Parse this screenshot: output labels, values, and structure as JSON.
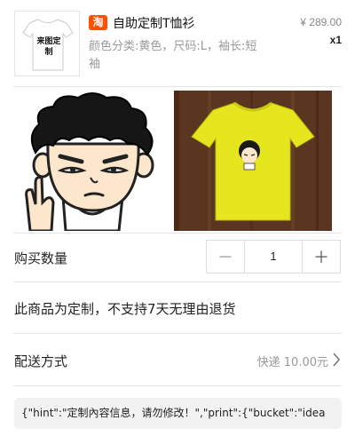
{
  "product": {
    "store_badge": "淘",
    "title": "自助定制T恤衫",
    "options": "颜色分类:黄色，尺码:L，袖长:短袖",
    "price": "¥ 289.00",
    "quantity_tag": "x1",
    "thumb_label": "来图定制",
    "shirt_color": "#ffffff",
    "badge_color": "#ff5000"
  },
  "custom_images": {
    "left": "cartoon-face-illustration",
    "right": "yellow-tshirt-on-wood-photo",
    "shirt_color": "#e6e61e",
    "wood_color": "#5a3620"
  },
  "quantity": {
    "label": "购买数量",
    "minus": "－",
    "value": "1",
    "plus": "＋"
  },
  "notice": "此商品为定制，不支持7天无理由退货",
  "shipping": {
    "label": "配送方式",
    "value": "快递 10.00元",
    "icon": "chevron-right-icon"
  },
  "custom_data": "{\"hint\":\"定制內容信息，请勿修改！\",\"print\":{\"bucket\":\"idea"
}
